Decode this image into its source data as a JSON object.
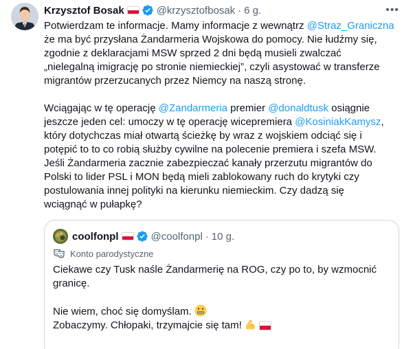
{
  "author": {
    "name": "Krzysztof Bosak",
    "handle": "@krzysztofbosak",
    "separator": "·",
    "time": "6 g."
  },
  "colors": {
    "mention": "#1d9bf0",
    "secondary_text": "#536471",
    "verified_badge": "#1d9bf0",
    "flag_red": "#dc143c",
    "border": "#cfd9de"
  },
  "tweet": {
    "p1": {
      "l1a": "Potwierdzam te informacje. Mamy informacje z wewnątrz ",
      "l1m": "@Straz_Graniczna",
      "l2": "że ma być przysłana Żandarmeria Wojskowa do pomocy. Nie łudźmy się,",
      "l3": "zgodnie z deklaracjami MSW sprzed 2 dni będą musieli zwalczać",
      "l4": "„nielegalną imigrację po stronie niemieckiej”, czyli asystować w transferze",
      "l5": "migrantów przerzucanych przez Niemcy na naszą stronę."
    },
    "p2": {
      "l1a": "Wciągając w tę operację ",
      "l1m1": "@Zandarmeria",
      "l1b": " premier ",
      "l1m2": "@donaldtusk",
      "l1c": " osiągnie",
      "l2a": "jeszcze jeden cel: umoczy w tę operację wicepremiera ",
      "l2m": "@KosiniakKamysz",
      "l2b": ",",
      "l3": "który dotychczas miał otwartą ścieżkę by wraz z wojskiem odciąć się i",
      "l4": "potępić to to co robią służby cywilne na polecenie premiera i szefa MSW.",
      "l5": "Jeśli Żandarmeria zacznie zabezpieczać kanały przerzutu migrantów do",
      "l6": "Polski to lider PSL i MON będą mieli zablokowany ruch do krytyki czy",
      "l7": "postulowania innej polityki na kierunku niemieckim. Czy dadzą się",
      "l8": "wciągnąć w pułapkę?"
    }
  },
  "quote": {
    "name": "coolfonpl",
    "handle": "@coolfonpl",
    "separator": "·",
    "time": "10 g.",
    "parody_label": "Konto parodystyczne",
    "l1": "Ciekawe czy Tusk naśle Żandarmerię na ROG, czy po to, by wzmocnić",
    "l2": "granicę.",
    "l3": "Nie wiem, choć się domyślam. ",
    "l4": "Zobaczymy. Chłopaki, trzymajcie się tam! ",
    "icons": [
      "grimace-emoji",
      "flexed-biceps-emoji",
      "poland-flag-emoji"
    ]
  },
  "icons": {
    "verified": "verified-badge-icon",
    "more": "more-options-icon",
    "parody": "theater-mask-icon"
  }
}
